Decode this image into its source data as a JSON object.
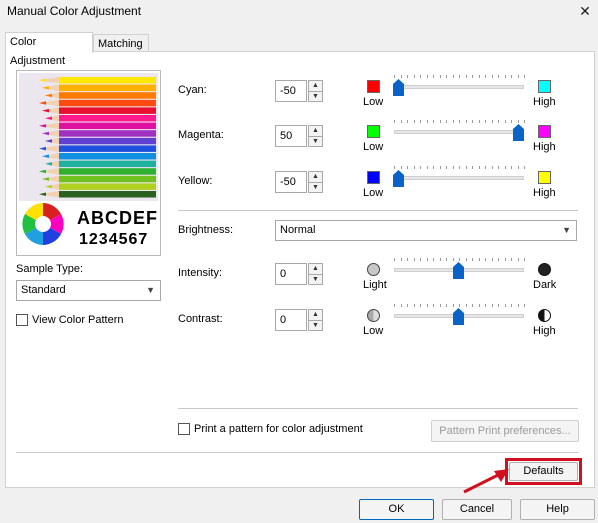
{
  "window": {
    "title": "Manual Color Adjustment"
  },
  "tabs": [
    {
      "label": "Color Adjustment"
    },
    {
      "label": "Matching"
    }
  ],
  "preview": {
    "letters": "ABCDEF",
    "numbers": "1234567"
  },
  "sample_type": {
    "label": "Sample Type:",
    "value": "Standard"
  },
  "view_color_pattern": {
    "label": "View Color Pattern",
    "checked": false
  },
  "sliders": {
    "cyan": {
      "label": "Cyan:",
      "value": "-50",
      "low": "Low",
      "high": "High",
      "low_color": "#ff0000",
      "high_color": "#00ffff",
      "position": 0.0
    },
    "magenta": {
      "label": "Magenta:",
      "value": "50",
      "low": "Low",
      "high": "High",
      "low_color": "#00ff00",
      "high_color": "#ff00ff",
      "position": 1.0
    },
    "yellow": {
      "label": "Yellow:",
      "value": "-50",
      "low": "Low",
      "high": "High",
      "low_color": "#0000ff",
      "high_color": "#ffff00",
      "position": 0.0
    },
    "intensity": {
      "label": "Intensity:",
      "value": "0",
      "low": "Light",
      "high": "Dark",
      "position": 0.5
    },
    "contrast": {
      "label": "Contrast:",
      "value": "0",
      "low": "Low",
      "high": "High",
      "position": 0.5
    }
  },
  "brightness": {
    "label": "Brightness:",
    "value": "Normal"
  },
  "print_pattern": {
    "label": "Print a pattern for color adjustment",
    "checked": false
  },
  "buttons": {
    "pattern_print_preferences": "Pattern Print preferences...",
    "defaults": "Defaults",
    "ok": "OK",
    "cancel": "Cancel",
    "help": "Help"
  }
}
